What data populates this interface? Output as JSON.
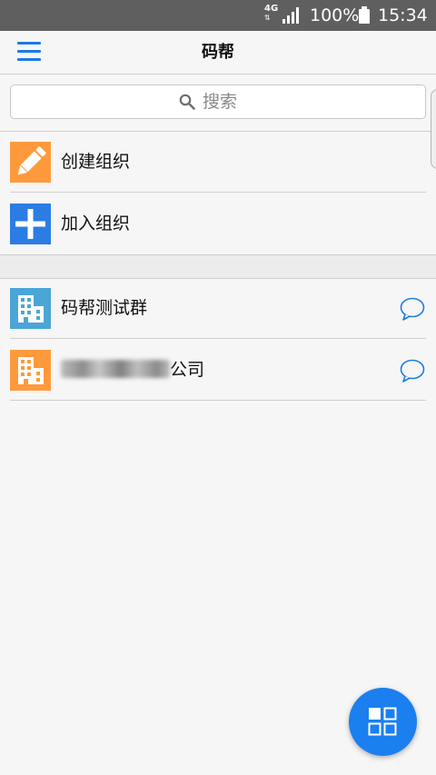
{
  "status_bar": {
    "network": "4G",
    "battery_percent": "100%",
    "time": "15:34"
  },
  "app_bar": {
    "title": "码帮"
  },
  "search": {
    "placeholder": "搜索"
  },
  "actions": [
    {
      "label": "创建组织",
      "icon": "pencil-icon",
      "color": "#ff9a3c"
    },
    {
      "label": "加入组织",
      "icon": "plus-icon",
      "color": "#2b7de3"
    }
  ],
  "organizations": [
    {
      "name": "码帮测试群",
      "icon": "building-icon",
      "color": "#4aa6d6"
    },
    {
      "name_suffix": "公司",
      "icon": "building-icon",
      "color": "#ff9a3c"
    }
  ],
  "colors": {
    "accent": "#1a7be8",
    "fab": "#1b7ff0"
  }
}
